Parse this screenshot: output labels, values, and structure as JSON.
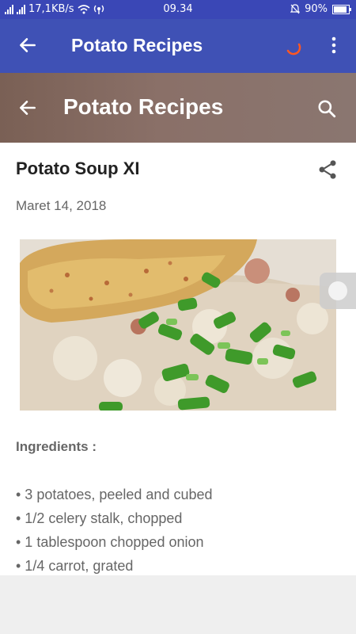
{
  "status_bar": {
    "net_speed": "17,1KB/s",
    "time": "09.34",
    "battery": "90%",
    "battery_level": 0.9
  },
  "app_bar": {
    "title": "Potato Recipes",
    "icons": [
      "back-arrow-icon",
      "loading-spinner-icon",
      "more-vert-icon"
    ]
  },
  "web_header": {
    "title": "Potato Recipes",
    "icons": [
      "back-arrow-icon",
      "search-icon"
    ]
  },
  "post": {
    "title": "Potato Soup XI",
    "date": "Maret 14, 2018",
    "image_alt": "potato soup with toast and green onions",
    "ingredients_heading": "Ingredients :",
    "ingredients": [
      "• 3 potatoes, peeled and cubed",
      "• 1/2 celery stalk, chopped",
      "• 1 tablespoon chopped onion",
      "• 1/4 carrot, grated"
    ]
  },
  "colors": {
    "status_bar": "#3a47b6",
    "app_bar": "#3f51b5",
    "spinner": "#ff5722",
    "web_header": "#7f655b"
  }
}
